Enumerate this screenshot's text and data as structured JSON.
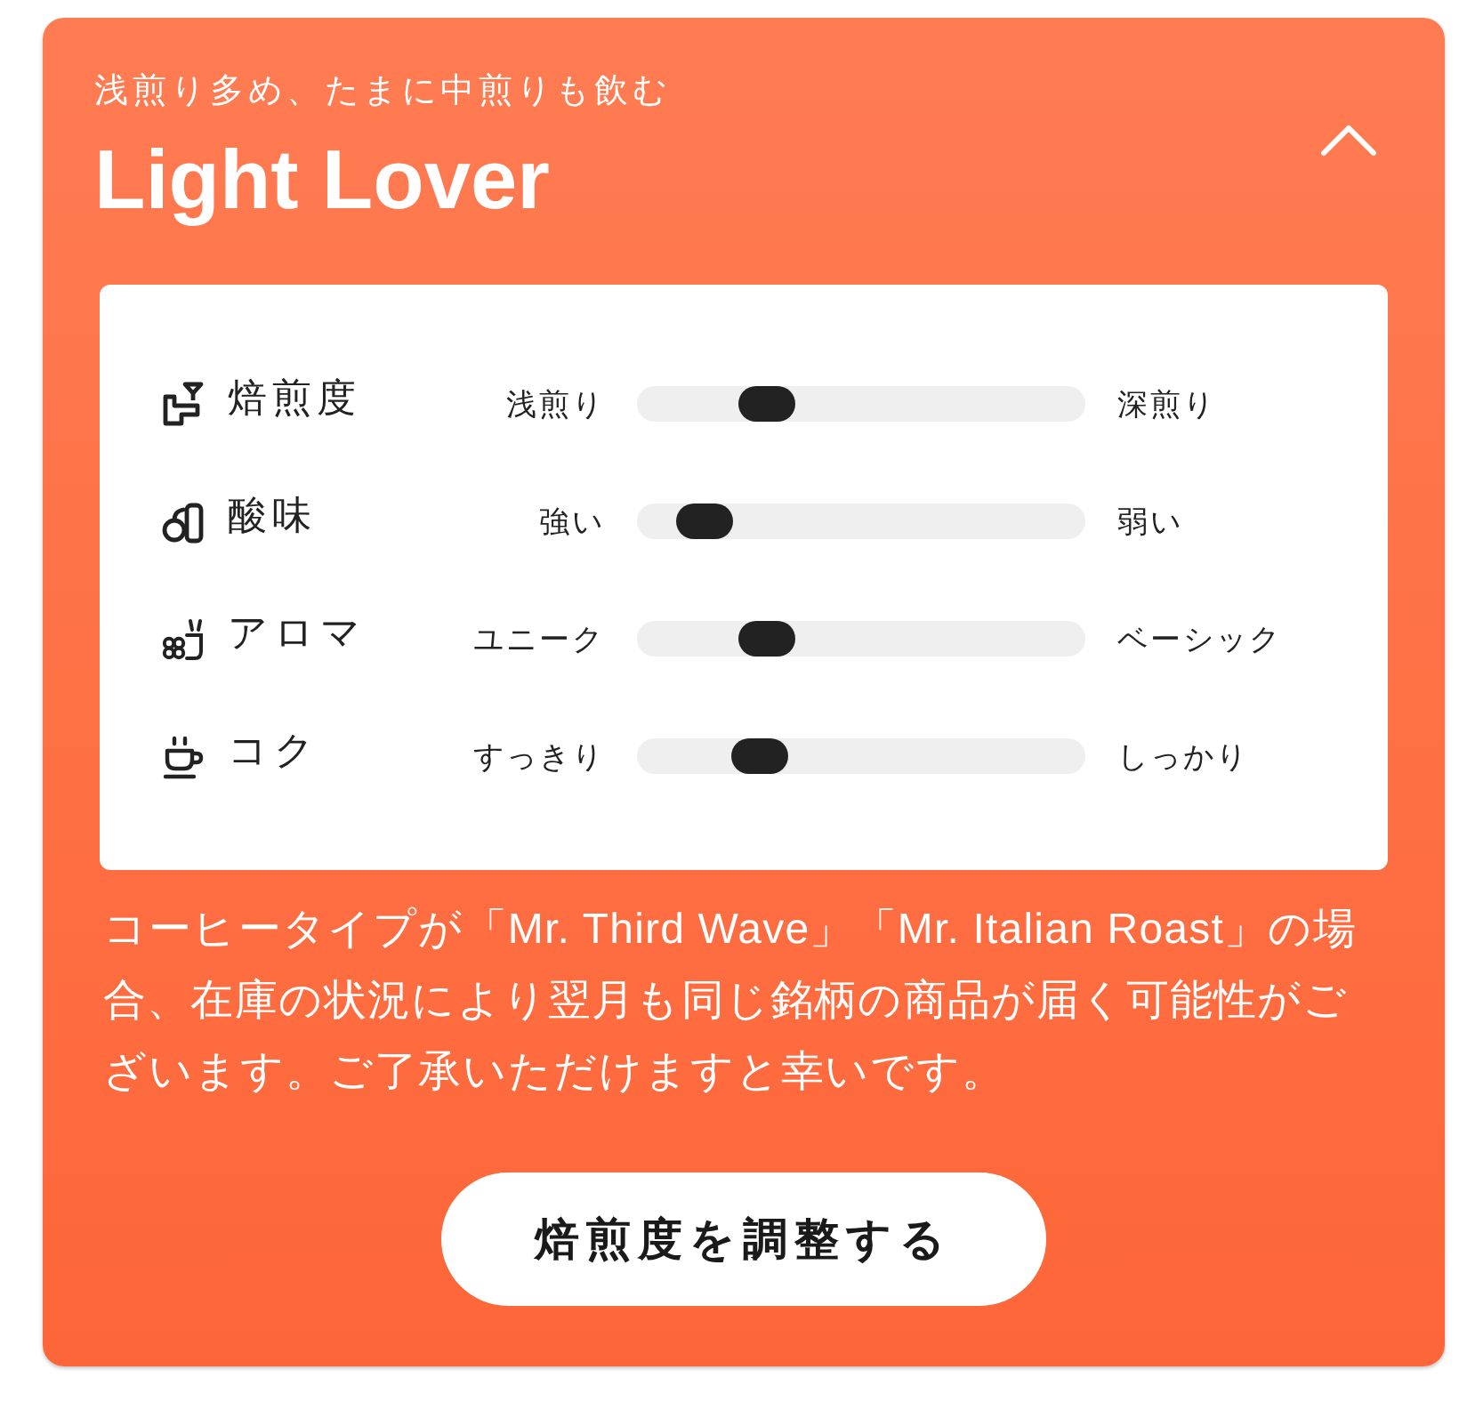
{
  "card": {
    "subtitle": "浅煎り多め、たまに中煎りも飲む",
    "title": "Light Lover",
    "expanded": true
  },
  "profile": [
    {
      "kind": "roast",
      "label": "焙煎度",
      "min_label": "浅煎り",
      "max_label": "深煎り",
      "level": 0.26
    },
    {
      "kind": "acidity",
      "label": "酸味",
      "min_label": "強い",
      "max_label": "弱い",
      "level": 0.1
    },
    {
      "kind": "aroma",
      "label": "アロマ",
      "min_label": "ユニーク",
      "max_label": "ベーシック",
      "level": 0.26
    },
    {
      "kind": "body",
      "label": "コク",
      "min_label": "すっきり",
      "max_label": "しっかり",
      "level": 0.24
    }
  ],
  "note": "コーヒータイプが「Mr. Third Wave」「Mr. Italian Roast」の場合、在庫の状況により翌月も同じ銘柄の商品が届く可能性がございます。ご了承いただけますと幸いです。",
  "button": "焙煎度を調整する"
}
